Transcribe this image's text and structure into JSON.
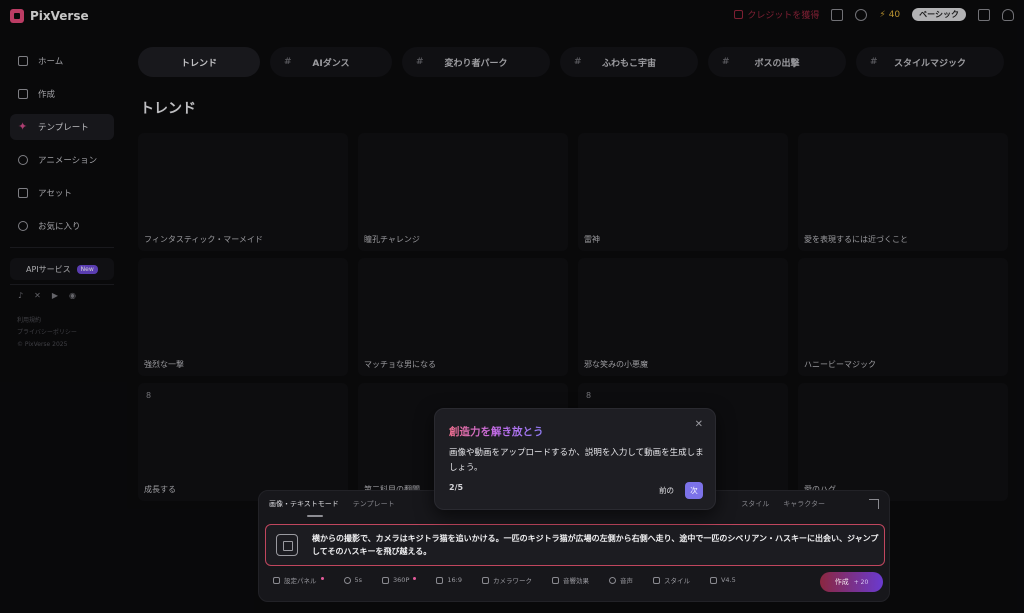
{
  "app": {
    "name": "PixVerse"
  },
  "header": {
    "gift_label": "クレジットを獲得",
    "credits": "40",
    "plan": "ベーシック"
  },
  "sidebar": {
    "items": [
      {
        "label": "ホーム",
        "icon": "home-icon"
      },
      {
        "label": "作成",
        "icon": "video-icon"
      },
      {
        "label": "テンプレート",
        "icon": "sparkle-icon"
      },
      {
        "label": "アニメーション",
        "icon": "anime-icon"
      },
      {
        "label": "アセット",
        "icon": "folder-icon"
      },
      {
        "label": "お気に入り",
        "icon": "heart-icon"
      }
    ],
    "api_label": "APIサービス",
    "api_badge": "New",
    "footer": [
      "利用規約",
      "プライバシーポリシー",
      "© PixVerse 2025"
    ]
  },
  "categories": [
    {
      "label": "トレンド",
      "hash": ""
    },
    {
      "label": "AIダンス",
      "hash": "#"
    },
    {
      "label": "変わり者パーク",
      "hash": "#"
    },
    {
      "label": "ふわもこ宇宙",
      "hash": "#"
    },
    {
      "label": "ボスの出撃",
      "hash": "#"
    },
    {
      "label": "スタイルマジック",
      "hash": "#"
    }
  ],
  "section_title": "トレンド",
  "cards": [
    {
      "label": "フィンタスティック・マーメイド",
      "icon": ""
    },
    {
      "label": "瞳孔チャレンジ",
      "icon": ""
    },
    {
      "label": "雷神",
      "icon": ""
    },
    {
      "label": "愛を表現するには近づくこと",
      "icon": ""
    },
    {
      "label": "強烈な一撃",
      "icon": ""
    },
    {
      "label": "マッチョな男になる",
      "icon": ""
    },
    {
      "label": "邪な笑みの小悪魔",
      "icon": ""
    },
    {
      "label": "ハニービーマジック",
      "icon": ""
    },
    {
      "label": "成長する",
      "icon": "8"
    },
    {
      "label": "第二科目の翻聞",
      "icon": ""
    },
    {
      "label": "",
      "icon": "8"
    },
    {
      "label": "愛のハグ",
      "icon": ""
    }
  ],
  "prompt_panel": {
    "tabs": [
      "画像・テキストモード",
      "テンプレート"
    ],
    "right_tabs": [
      "スタイル",
      "キャラクター"
    ],
    "prompt": "横からの撮影で、カメラはキジトラ猫を追いかける。一匹のキジトラ猫が広場の左側から右側へ走り、途中で一匹のシベリアン・ハスキーに出会い、ジャンプしてそのハスキーを飛び越える。",
    "controls": [
      "設定パネル",
      "5s",
      "360P",
      "16:9",
      "カメラワーク",
      "音響効果",
      "音声",
      "スタイル",
      "V4.5"
    ],
    "create_label": "作成",
    "create_cost": "+ 20"
  },
  "tour": {
    "title": "創造力を解き放とう",
    "body": "画像や動画をアップロードするか、説明を入力して動画を生成しましょう。",
    "step": "2/5",
    "prev": "前の",
    "next": "次"
  }
}
